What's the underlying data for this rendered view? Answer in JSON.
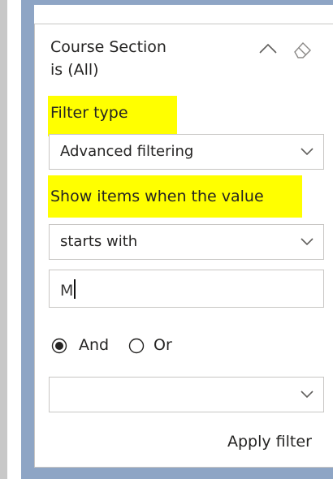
{
  "filter_card": {
    "title_line1": "Course Section",
    "title_line2": "is (All)",
    "collapse_icon": "chevron-up-icon",
    "clear_icon": "eraser-icon"
  },
  "filter_type": {
    "label": "Filter type",
    "selected": "Advanced filtering"
  },
  "condition": {
    "label": "Show items when the value",
    "operator_selected": "starts with",
    "value": "M",
    "second_operator_selected": ""
  },
  "logic": {
    "and_label": "And",
    "or_label": "Or",
    "selected": "And"
  },
  "apply_label": "Apply filter",
  "colors": {
    "highlight": "#ffff00",
    "frame": "#8ea5c5",
    "border": "#c8c6c4"
  }
}
